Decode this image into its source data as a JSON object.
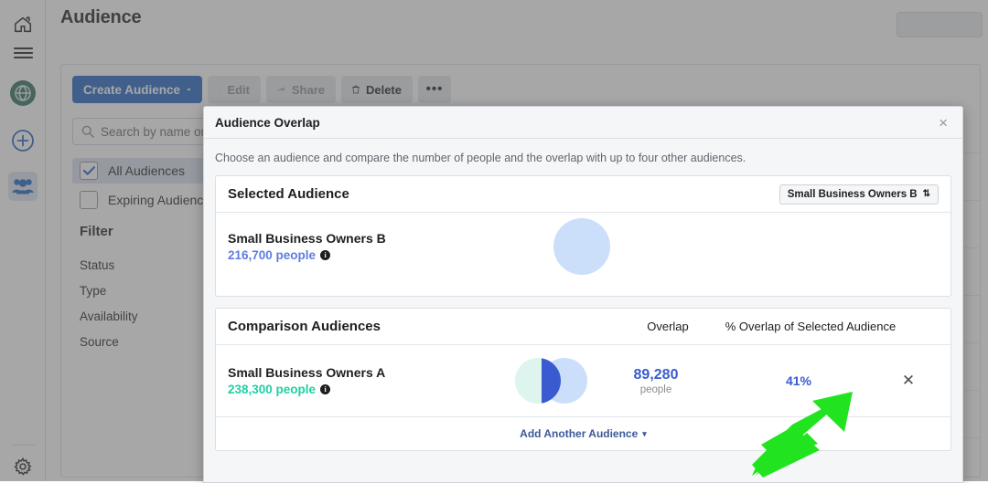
{
  "app": {
    "page_title": "Audience"
  },
  "rail": {
    "items": [
      {
        "name": "home-icon",
        "label": "Home"
      },
      {
        "name": "menu-icon",
        "label": "Menu"
      },
      {
        "name": "globe-icon",
        "label": "Business"
      },
      {
        "name": "plus-circle-icon",
        "label": "Create"
      },
      {
        "name": "people-icon",
        "label": "Audiences"
      },
      {
        "name": "gear-icon",
        "label": "Settings"
      }
    ]
  },
  "toolbar": {
    "create_label": "Create Audience",
    "edit_label": "Edit",
    "share_label": "Share",
    "delete_label": "Delete",
    "more_label": "•••"
  },
  "search": {
    "placeholder": "Search by name or au"
  },
  "filters": {
    "checkboxes": [
      {
        "label": "All Audiences",
        "checked": true
      },
      {
        "label": "Expiring Audiences",
        "checked": false
      }
    ],
    "title": "Filter",
    "items": [
      "Status",
      "Type",
      "Availability",
      "Source"
    ]
  },
  "modal": {
    "title": "Audience Overlap",
    "close_label": "×",
    "description": "Choose an audience and compare the number of people and the overlap with up to four other audiences.",
    "selected": {
      "heading": "Selected Audience",
      "dropdown_value": "Small Business Owners B",
      "dropdown_caret": "⇅",
      "audience_name": "Small Business Owners B",
      "audience_count": "216,700 people",
      "info_glyph": "i"
    },
    "comparison": {
      "heading": "Comparison Audiences",
      "col_overlap": "Overlap",
      "col_percent": "% Overlap of Selected Audience",
      "rows": [
        {
          "audience_name": "Small Business Owners A",
          "audience_count": "238,300 people",
          "info_glyph": "i",
          "overlap_value": "89,280",
          "overlap_unit": "people",
          "percent": "41%",
          "remove_label": "✕"
        }
      ],
      "add_another_label": "Add Another Audience",
      "add_another_caret": "▾"
    }
  },
  "annotation": {
    "arrow_color": "#22e320",
    "points_to": "41%"
  },
  "colors": {
    "primary_blue": "#1b5fc1",
    "overlap_blue": "#3a5bd0",
    "audience_b_blue": "#5e7ce0",
    "audience_a_teal": "#1fd0a3",
    "venn_left": "#ddf5ee",
    "venn_right": "#cbdefa",
    "link_blue": "#3b5998"
  }
}
